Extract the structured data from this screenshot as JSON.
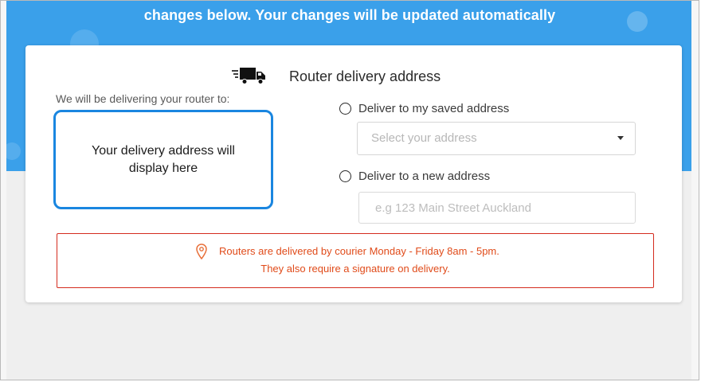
{
  "header": {
    "title": "changes below. Your changes will be updated automatically"
  },
  "card": {
    "title": "Router delivery address",
    "truck_icon": "delivery-truck-icon",
    "left_label": "We will be delivering your router to:",
    "address_placeholder": "Your delivery address will\ndisplay here",
    "options": [
      {
        "label": "Deliver to my saved address",
        "selected": false
      },
      {
        "label": "Deliver to a new address",
        "selected": false
      }
    ],
    "select": {
      "placeholder": "Select your address",
      "icon": "chevron-down-icon"
    },
    "new_address_input": {
      "value": "",
      "placeholder": "e.g 123 Main Street Auckland"
    },
    "notice": {
      "icon": "location-pin-icon",
      "line1": "Routers are delivered by courier Monday - Friday 8am - 5pm.",
      "line2": "They also require a signature on delivery."
    }
  },
  "colors": {
    "hero": "#3aa0ea",
    "accent_border": "#1a86e0",
    "notice_border": "#d42b1e",
    "notice_text": "#e04b1a"
  }
}
